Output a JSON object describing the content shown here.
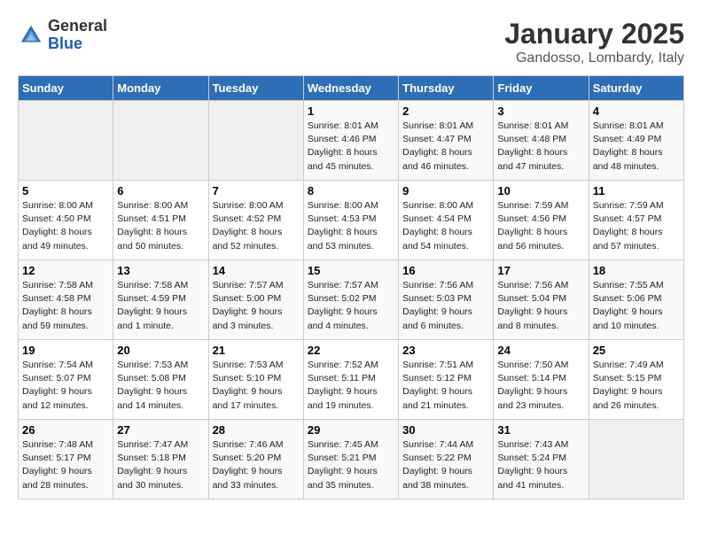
{
  "logo": {
    "general": "General",
    "blue": "Blue"
  },
  "title": "January 2025",
  "subtitle": "Gandosso, Lombardy, Italy",
  "weekdays": [
    "Sunday",
    "Monday",
    "Tuesday",
    "Wednesday",
    "Thursday",
    "Friday",
    "Saturday"
  ],
  "weeks": [
    [
      {
        "day": "",
        "info": ""
      },
      {
        "day": "",
        "info": ""
      },
      {
        "day": "",
        "info": ""
      },
      {
        "day": "1",
        "info": "Sunrise: 8:01 AM\nSunset: 4:46 PM\nDaylight: 8 hours\nand 45 minutes."
      },
      {
        "day": "2",
        "info": "Sunrise: 8:01 AM\nSunset: 4:47 PM\nDaylight: 8 hours\nand 46 minutes."
      },
      {
        "day": "3",
        "info": "Sunrise: 8:01 AM\nSunset: 4:48 PM\nDaylight: 8 hours\nand 47 minutes."
      },
      {
        "day": "4",
        "info": "Sunrise: 8:01 AM\nSunset: 4:49 PM\nDaylight: 8 hours\nand 48 minutes."
      }
    ],
    [
      {
        "day": "5",
        "info": "Sunrise: 8:00 AM\nSunset: 4:50 PM\nDaylight: 8 hours\nand 49 minutes."
      },
      {
        "day": "6",
        "info": "Sunrise: 8:00 AM\nSunset: 4:51 PM\nDaylight: 8 hours\nand 50 minutes."
      },
      {
        "day": "7",
        "info": "Sunrise: 8:00 AM\nSunset: 4:52 PM\nDaylight: 8 hours\nand 52 minutes."
      },
      {
        "day": "8",
        "info": "Sunrise: 8:00 AM\nSunset: 4:53 PM\nDaylight: 8 hours\nand 53 minutes."
      },
      {
        "day": "9",
        "info": "Sunrise: 8:00 AM\nSunset: 4:54 PM\nDaylight: 8 hours\nand 54 minutes."
      },
      {
        "day": "10",
        "info": "Sunrise: 7:59 AM\nSunset: 4:56 PM\nDaylight: 8 hours\nand 56 minutes."
      },
      {
        "day": "11",
        "info": "Sunrise: 7:59 AM\nSunset: 4:57 PM\nDaylight: 8 hours\nand 57 minutes."
      }
    ],
    [
      {
        "day": "12",
        "info": "Sunrise: 7:58 AM\nSunset: 4:58 PM\nDaylight: 8 hours\nand 59 minutes."
      },
      {
        "day": "13",
        "info": "Sunrise: 7:58 AM\nSunset: 4:59 PM\nDaylight: 9 hours\nand 1 minute."
      },
      {
        "day": "14",
        "info": "Sunrise: 7:57 AM\nSunset: 5:00 PM\nDaylight: 9 hours\nand 3 minutes."
      },
      {
        "day": "15",
        "info": "Sunrise: 7:57 AM\nSunset: 5:02 PM\nDaylight: 9 hours\nand 4 minutes."
      },
      {
        "day": "16",
        "info": "Sunrise: 7:56 AM\nSunset: 5:03 PM\nDaylight: 9 hours\nand 6 minutes."
      },
      {
        "day": "17",
        "info": "Sunrise: 7:56 AM\nSunset: 5:04 PM\nDaylight: 9 hours\nand 8 minutes."
      },
      {
        "day": "18",
        "info": "Sunrise: 7:55 AM\nSunset: 5:06 PM\nDaylight: 9 hours\nand 10 minutes."
      }
    ],
    [
      {
        "day": "19",
        "info": "Sunrise: 7:54 AM\nSunset: 5:07 PM\nDaylight: 9 hours\nand 12 minutes."
      },
      {
        "day": "20",
        "info": "Sunrise: 7:53 AM\nSunset: 5:08 PM\nDaylight: 9 hours\nand 14 minutes."
      },
      {
        "day": "21",
        "info": "Sunrise: 7:53 AM\nSunset: 5:10 PM\nDaylight: 9 hours\nand 17 minutes."
      },
      {
        "day": "22",
        "info": "Sunrise: 7:52 AM\nSunset: 5:11 PM\nDaylight: 9 hours\nand 19 minutes."
      },
      {
        "day": "23",
        "info": "Sunrise: 7:51 AM\nSunset: 5:12 PM\nDaylight: 9 hours\nand 21 minutes."
      },
      {
        "day": "24",
        "info": "Sunrise: 7:50 AM\nSunset: 5:14 PM\nDaylight: 9 hours\nand 23 minutes."
      },
      {
        "day": "25",
        "info": "Sunrise: 7:49 AM\nSunset: 5:15 PM\nDaylight: 9 hours\nand 26 minutes."
      }
    ],
    [
      {
        "day": "26",
        "info": "Sunrise: 7:48 AM\nSunset: 5:17 PM\nDaylight: 9 hours\nand 28 minutes."
      },
      {
        "day": "27",
        "info": "Sunrise: 7:47 AM\nSunset: 5:18 PM\nDaylight: 9 hours\nand 30 minutes."
      },
      {
        "day": "28",
        "info": "Sunrise: 7:46 AM\nSunset: 5:20 PM\nDaylight: 9 hours\nand 33 minutes."
      },
      {
        "day": "29",
        "info": "Sunrise: 7:45 AM\nSunset: 5:21 PM\nDaylight: 9 hours\nand 35 minutes."
      },
      {
        "day": "30",
        "info": "Sunrise: 7:44 AM\nSunset: 5:22 PM\nDaylight: 9 hours\nand 38 minutes."
      },
      {
        "day": "31",
        "info": "Sunrise: 7:43 AM\nSunset: 5:24 PM\nDaylight: 9 hours\nand 41 minutes."
      },
      {
        "day": "",
        "info": ""
      }
    ]
  ]
}
